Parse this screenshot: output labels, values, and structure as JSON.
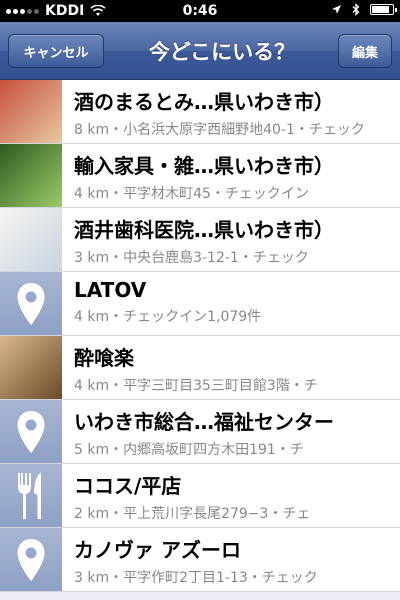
{
  "status_bar": {
    "carrier": "KDDI",
    "time": "0:46",
    "battery_level": 0.9
  },
  "nav": {
    "cancel_label": "キャンセル",
    "title": "今どこにいる？",
    "edit_label": "編集"
  },
  "places": [
    {
      "title": "酒のまるとみ…県いわき市）",
      "subtitle": "8 km・小名浜大原字西細野地40-1・チェック",
      "thumb": "photo",
      "thumb_icon": "store-photo-icon",
      "thumb_colors": [
        "#c8503c",
        "#e8c8a0"
      ]
    },
    {
      "title": "輸入家具・雑…県いわき市）",
      "subtitle": "4 km・平字材木町45・チェックイン",
      "thumb": "photo",
      "thumb_icon": "furniture-store-photo-icon",
      "thumb_colors": [
        "#2f5a1f",
        "#9acb68"
      ]
    },
    {
      "title": "酒井歯科医院…県いわき市）",
      "subtitle": "3 km・中央台鹿島3-12-1・チェック",
      "thumb": "photo",
      "thumb_icon": "clinic-photo-icon",
      "thumb_colors": [
        "#f4f4f4",
        "#c9d4de"
      ]
    },
    {
      "title": "LATOV",
      "subtitle": "4 km・チェックイン1,079件",
      "thumb": "pin",
      "thumb_icon": "location-pin-icon"
    },
    {
      "title": "酔喰楽",
      "subtitle": "4 km・平字三町目35三町目館3階・チ",
      "thumb": "photo",
      "thumb_icon": "caricature-photo-icon",
      "thumb_colors": [
        "#d9b98a",
        "#6b4a2a"
      ]
    },
    {
      "title": "いわき市総合…福祉センター",
      "subtitle": "5 km・内郷高坂町四方木田191・チ",
      "thumb": "pin",
      "thumb_icon": "location-pin-icon"
    },
    {
      "title": "ココス/平店",
      "subtitle": "2 km・平上荒川字長尾279−3・チェ",
      "thumb": "food",
      "thumb_icon": "fork-knife-icon"
    },
    {
      "title": "カノヴァ アズーロ",
      "subtitle": "3 km・平字作町2丁目1-13・チェック",
      "thumb": "pin",
      "thumb_icon": "location-pin-icon"
    }
  ]
}
